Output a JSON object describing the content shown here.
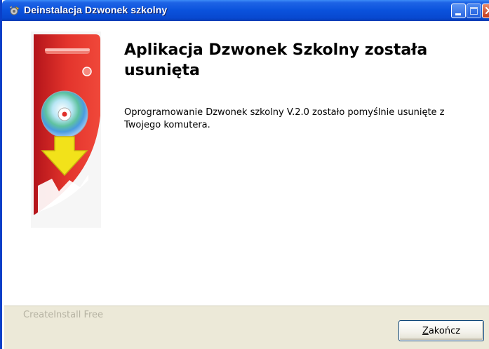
{
  "window": {
    "title": "Deinstalacja Dzwonek szkolny",
    "title_icon": "installer-gear-icon"
  },
  "main": {
    "heading": "Aplikacja Dzwonek Szkolny została usunięta",
    "message": "Oprogramowanie Dzwonek szkolny V.2.0 zostało pomyślnie usunięte z Twojego komutera."
  },
  "footer": {
    "brand": "CreateInstall Free",
    "finish_prefix": "",
    "finish_accel": "Z",
    "finish_rest": "akończ"
  },
  "colors": {
    "titlebar_blue": "#0a52dc",
    "graphic_red": "#e0302a",
    "arrow_yellow": "#f2e21a",
    "bottom_bar": "#ece9d8"
  }
}
